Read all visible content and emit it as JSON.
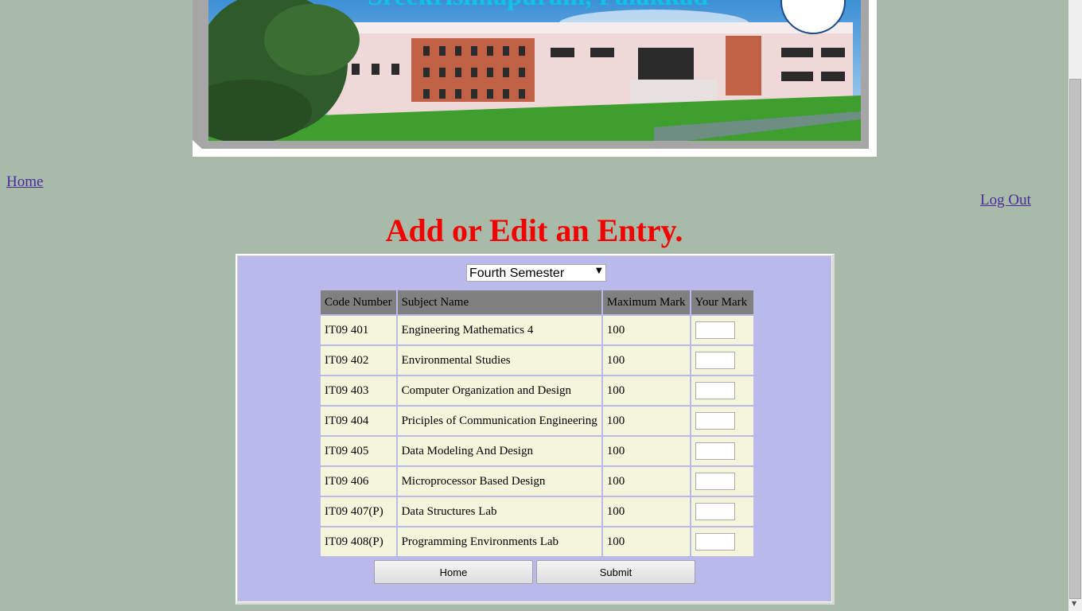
{
  "banner": {
    "image": "college-building-photo",
    "caption_text": "Sreekrishnapuram, Palakkad"
  },
  "nav": {
    "home_label": "Home",
    "logout_label": "Log Out"
  },
  "title": "Add or Edit an Entry.",
  "form": {
    "semester": {
      "selected": "Fourth Semester",
      "arrow_icon": "dropdown-arrow-icon"
    },
    "columns": [
      "Code Number",
      "Subject Name",
      "Maximum Mark",
      "Your Mark"
    ],
    "rows": [
      {
        "code": "IT09 401",
        "subject": "Engineering Mathematics 4",
        "max": "100",
        "mark": ""
      },
      {
        "code": "IT09 402",
        "subject": "Environmental Studies",
        "max": "100",
        "mark": ""
      },
      {
        "code": "IT09 403",
        "subject": "Computer Organization and Design",
        "max": "100",
        "mark": ""
      },
      {
        "code": "IT09 404",
        "subject": "Priciples of Communication Engineering",
        "max": "100",
        "mark": ""
      },
      {
        "code": "IT09 405",
        "subject": "Data Modeling And Design",
        "max": "100",
        "mark": ""
      },
      {
        "code": "IT09 406",
        "subject": "Microprocessor Based Design",
        "max": "100",
        "mark": ""
      },
      {
        "code": "IT09 407(P)",
        "subject": "Data Structures Lab",
        "max": "100",
        "mark": ""
      },
      {
        "code": "IT09 408(P)",
        "subject": "Programming Environments Lab",
        "max": "100",
        "mark": ""
      }
    ],
    "buttons": {
      "home": "Home",
      "submit": "Submit"
    }
  },
  "colors": {
    "page_bg": "#a8baa8",
    "title": "#f30000",
    "panel_bg": "#b9b9ec",
    "header_bg": "#808080",
    "cell_bg": "#f5f5dc",
    "link": "#4b2aa0"
  }
}
